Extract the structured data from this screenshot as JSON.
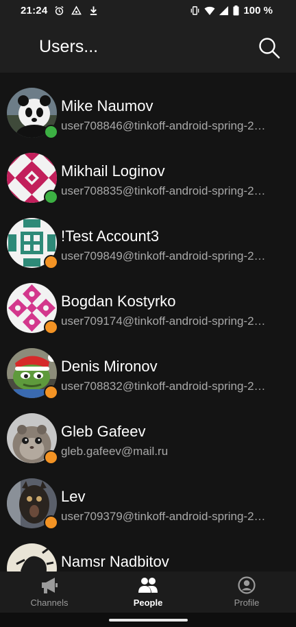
{
  "status_bar": {
    "time": "21:24",
    "battery": "100 %",
    "left_icons": [
      "alarm-icon",
      "triangle-icon",
      "download-icon"
    ],
    "right_icons": [
      "vibrate-icon",
      "wifi-icon",
      "signal-icon",
      "battery-icon"
    ]
  },
  "app_bar": {
    "title": "Users...",
    "search_icon": "search-icon"
  },
  "users": [
    {
      "name": "Mike Naumov",
      "email": "user708846@tinkoff-android-spring-2…",
      "status": "online",
      "avatar": "panda"
    },
    {
      "name": "Mikhail Loginov",
      "email": "user708835@tinkoff-android-spring-2…",
      "status": "online",
      "avatar": "identicon-magenta"
    },
    {
      "name": "!Test Account3",
      "email": "user709849@tinkoff-android-spring-2…",
      "status": "idle",
      "avatar": "identicon-teal"
    },
    {
      "name": "Bogdan Kostyrko",
      "email": "user709174@tinkoff-android-spring-2…",
      "status": "idle",
      "avatar": "identicon-pink"
    },
    {
      "name": "Denis Mironov",
      "email": "user708832@tinkoff-android-spring-2…",
      "status": "idle",
      "avatar": "frog"
    },
    {
      "name": "Gleb Gafeev",
      "email": "gleb.gafeev@mail.ru",
      "status": "idle",
      "avatar": "hamster"
    },
    {
      "name": "Lev",
      "email": "user709379@tinkoff-android-spring-2…",
      "status": "idle",
      "avatar": "dark-animal"
    },
    {
      "name": "Namsr Nadbitov",
      "email": "",
      "status": "",
      "avatar": "sketch"
    }
  ],
  "bottom_nav": {
    "items": [
      {
        "label": "Channels",
        "icon": "megaphone-icon",
        "active": false
      },
      {
        "label": "People",
        "icon": "people-icon",
        "active": true
      },
      {
        "label": "Profile",
        "icon": "profile-icon",
        "active": false
      }
    ]
  },
  "colors": {
    "background": "#141414",
    "app_bar": "#1f1f1f",
    "online": "#3cb043",
    "idle": "#f39324",
    "secondary_text": "#a8a8a8"
  }
}
